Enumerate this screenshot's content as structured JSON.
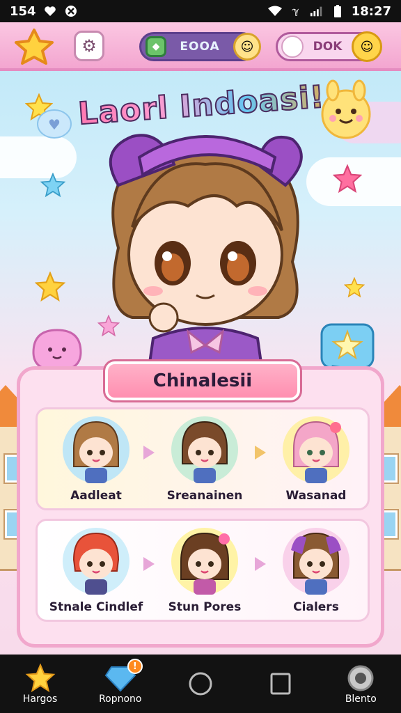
{
  "status_bar": {
    "time_left": "154",
    "time_right": "18:27"
  },
  "header": {
    "currency_1": "EOOA",
    "currency_2": "DOK"
  },
  "title": "Laorl Indoasi!",
  "panel": {
    "title": "Chinalesii",
    "rows": [
      [
        {
          "name": "Aadleat",
          "hair": "#b07a45",
          "disc": "#bfe6f6"
        },
        {
          "name": "Sreanainen",
          "hair": "#7a4a2a",
          "disc": "#c9ecd7"
        },
        {
          "name": "Wasanad",
          "hair": "#f4a6c8",
          "disc": "#fff0a8"
        }
      ],
      [
        {
          "name": "Stnale Cindlef",
          "hair": "#e8533a",
          "disc": "#cfeefa"
        },
        {
          "name": "Stun Pores",
          "hair": "#6b3f22",
          "disc": "#fff3a6"
        },
        {
          "name": "Cialers",
          "hair": "#8a5a33",
          "disc": "#f9d1ea"
        }
      ]
    ]
  },
  "nav": [
    {
      "label": "Hargos",
      "icon": "star-icon"
    },
    {
      "label": "Ropnono",
      "icon": "gem-icon",
      "badge": "!"
    },
    {
      "label": "",
      "icon": "home-circle-icon"
    },
    {
      "label": "",
      "icon": "recents-square-icon"
    },
    {
      "label": "Blento",
      "icon": "gear-icon"
    }
  ],
  "colors": {
    "accent": "#f3a6d0",
    "panel": "#fde0ef",
    "nav": "#121212"
  }
}
